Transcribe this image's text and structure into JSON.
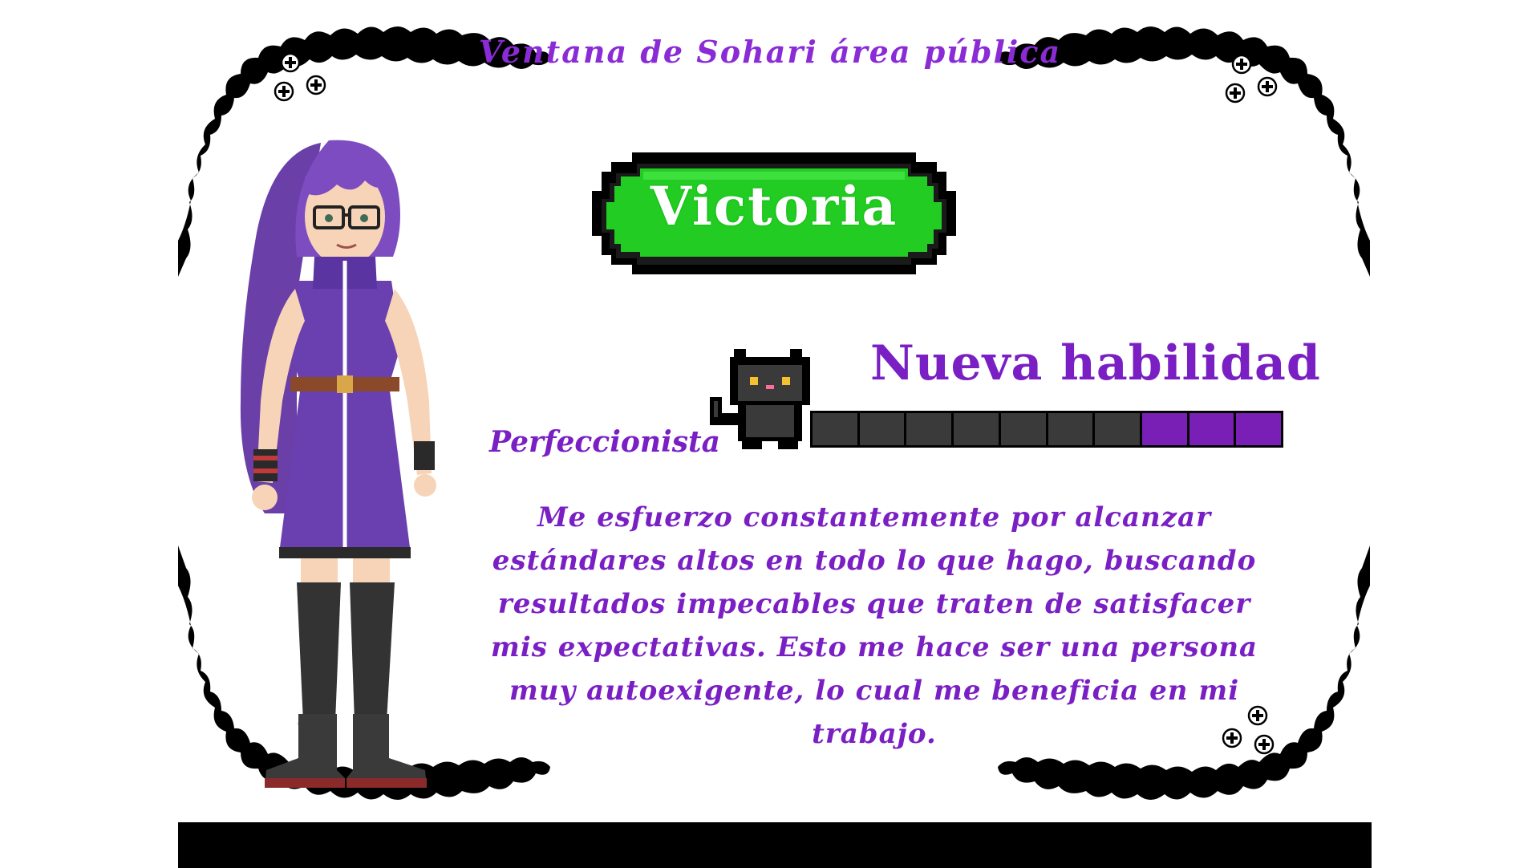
{
  "window": {
    "title": "Ventana de Sohari área pública"
  },
  "character": {
    "name": "Victoria"
  },
  "skill": {
    "heading": "Nueva habilidad",
    "name": "Perfeccionista",
    "level": 3,
    "max_level": 10,
    "description": "Me esfuerzo constantemente por alcanzar estándares altos en todo lo que hago, buscando resultados impecables que traten de satisfacer mis expectativas. Esto me hace ser una persona muy autoexigente, lo cual me beneficia en mi trabajo."
  },
  "colors": {
    "accent_purple": "#7a1fc4",
    "name_plate_green": "#22cc22",
    "progress_filled": "#7a1fb5",
    "progress_empty": "#3a3a3a"
  },
  "icons": [
    "sparkle-icon",
    "cat-icon"
  ]
}
